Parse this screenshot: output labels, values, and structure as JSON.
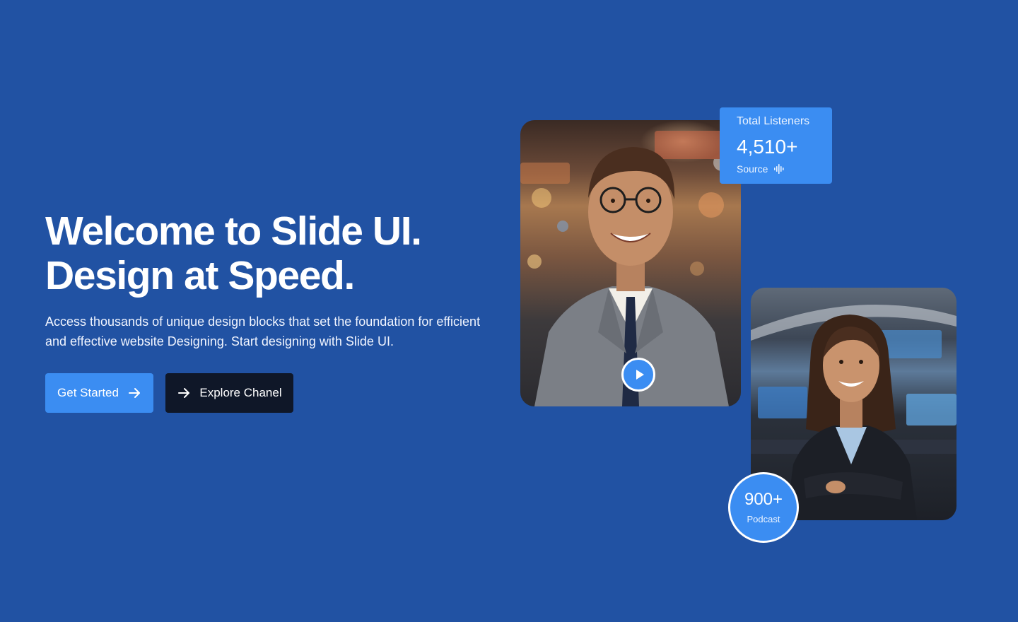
{
  "hero": {
    "title_line1": "Welcome to Slide UI.",
    "title_line2": "Design at Speed.",
    "description": "Access thousands of unique design blocks that set the foundation for efficient and effective website Designing. Start designing with Slide UI."
  },
  "buttons": {
    "get_started": "Get Started",
    "explore": "Explore Chanel"
  },
  "stats": {
    "label": "Total Listeners",
    "value": "4,510+",
    "source": "Source"
  },
  "podcast": {
    "value": "900+",
    "label": "Podcast"
  },
  "colors": {
    "background": "#2152a3",
    "accent": "#3b8df2",
    "dark_button": "#0f1728"
  },
  "icons": {
    "arrow": "arrow-right-icon",
    "play": "play-icon",
    "audio": "audio-waveform-icon"
  }
}
